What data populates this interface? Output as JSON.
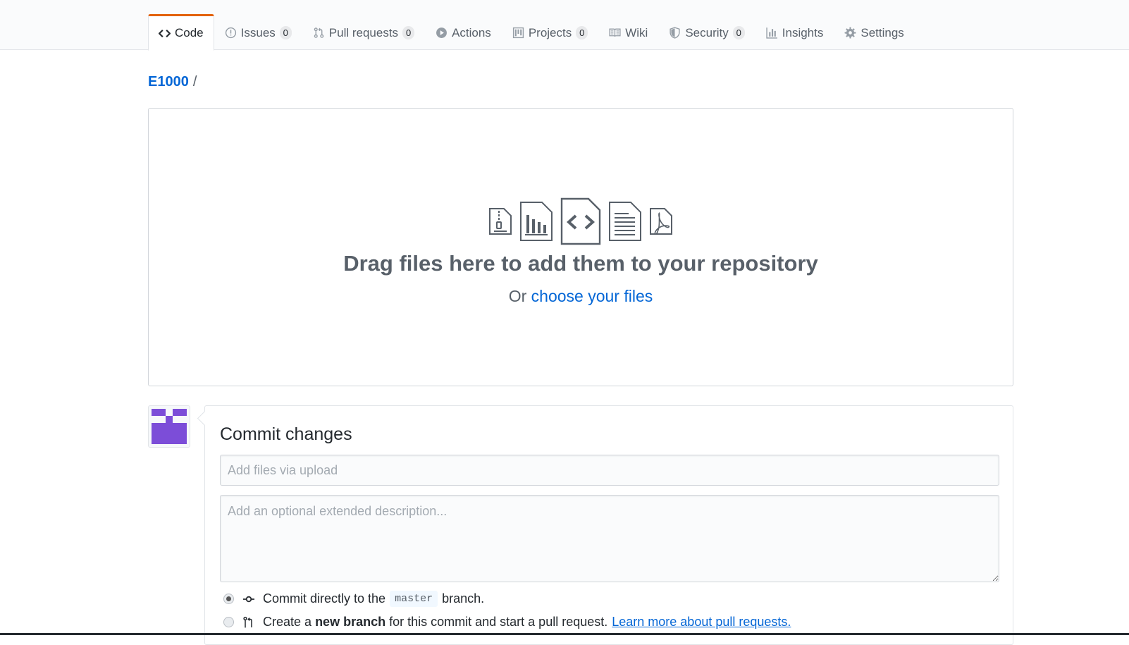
{
  "nav": {
    "tabs": [
      {
        "label": "Code",
        "icon": "code-icon"
      },
      {
        "label": "Issues",
        "count": "0",
        "icon": "issue-opened-icon"
      },
      {
        "label": "Pull requests",
        "count": "0",
        "icon": "git-pull-request-icon"
      },
      {
        "label": "Actions",
        "icon": "play-icon"
      },
      {
        "label": "Projects",
        "count": "0",
        "icon": "project-icon"
      },
      {
        "label": "Wiki",
        "icon": "book-icon"
      },
      {
        "label": "Security",
        "count": "0",
        "icon": "shield-icon"
      },
      {
        "label": "Insights",
        "icon": "graph-icon"
      },
      {
        "label": "Settings",
        "icon": "gear-icon"
      }
    ],
    "selected": "Code",
    "accent_color": "#e36209"
  },
  "breadcrumb": {
    "repo": "E1000",
    "separator": "/"
  },
  "dropzone": {
    "icons": [
      "file-zip-icon",
      "file-chart-icon",
      "file-code-icon",
      "file-text-icon",
      "file-pdf-icon"
    ],
    "title": "Drag files here to add them to your repository",
    "sub_prefix": "Or",
    "sub_link": "choose your files"
  },
  "commit": {
    "avatar_color": "#7c4dd8",
    "title": "Commit changes",
    "summary_placeholder": "Add files via upload",
    "description_placeholder": "Add an optional extended description...",
    "option_direct": {
      "prefix": "Commit directly to the",
      "branch": "master",
      "suffix": "branch.",
      "checked": true
    },
    "option_new_branch": {
      "prefix": "Create a",
      "bold": "new branch",
      "suffix": "for this commit and start a pull request.",
      "link": "Learn more about pull requests.",
      "checked": false
    }
  },
  "colors": {
    "link": "#0366d6",
    "muted": "#586069"
  }
}
